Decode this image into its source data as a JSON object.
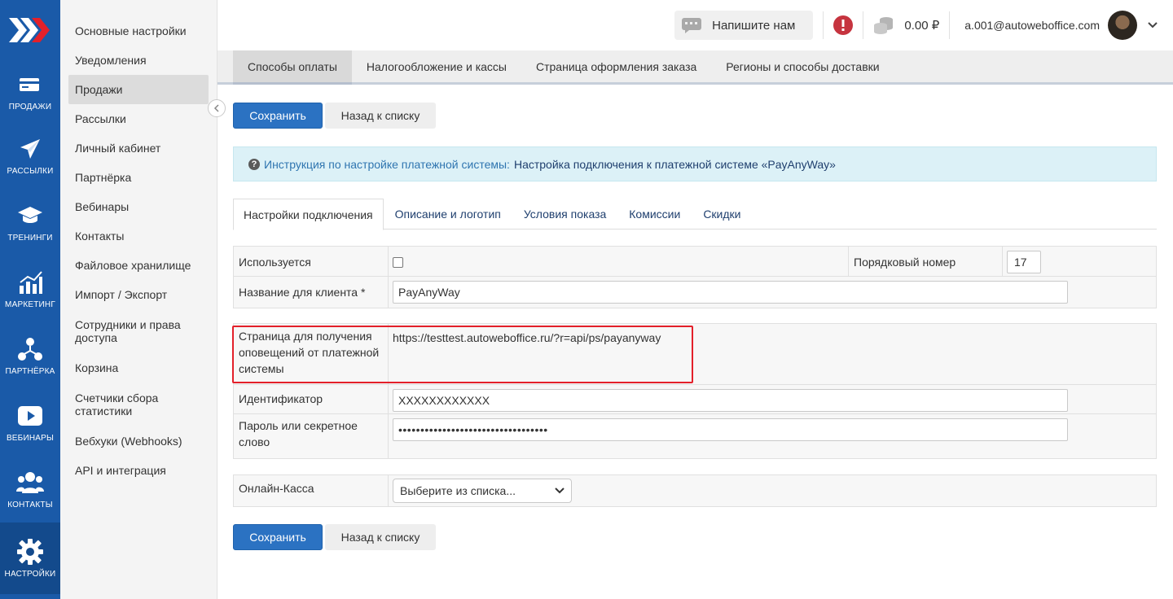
{
  "rail": {
    "items": [
      {
        "label": "Продажи",
        "icon": "card-icon"
      },
      {
        "label": "Рассылки",
        "icon": "paper-plane-icon"
      },
      {
        "label": "Тренинги",
        "icon": "graduation-cap-icon"
      },
      {
        "label": "Маркетинг",
        "icon": "bar-chart-icon"
      },
      {
        "label": "Партнёрка",
        "icon": "network-icon"
      },
      {
        "label": "Вебинары",
        "icon": "play-icon"
      },
      {
        "label": "Контакты",
        "icon": "users-icon"
      },
      {
        "label": "Настройки",
        "icon": "gear-icon"
      }
    ]
  },
  "sidebar": {
    "items": [
      "Основные настройки",
      "Уведомления",
      "Продажи",
      "Рассылки",
      "Личный кабинет",
      "Партнёрка",
      "Вебинары",
      "Контакты",
      "Файловое хранилище",
      "Импорт / Экспорт",
      "Сотрудники и права доступа",
      "Корзина",
      "Счетчики сбора статистики",
      "Вебхуки (Webhooks)",
      "API и интеграция"
    ],
    "active_index": 2
  },
  "header": {
    "write_us": "Напишите нам",
    "balance": "0.00 ₽",
    "email": "a.001@autoweboffice.com"
  },
  "top_tabs": [
    "Способы оплаты",
    "Налогообложение и кассы",
    "Страница оформления заказа",
    "Регионы и способы доставки"
  ],
  "buttons": {
    "save": "Сохранить",
    "back": "Назад к списку"
  },
  "alert": {
    "prefix": "Инструкция по настройке платежной системы:",
    "link": "Настройка подключения к платежной системе «PayAnyWay»"
  },
  "sub_tabs": [
    "Настройки подключения",
    "Описание и логотип",
    "Условия показа",
    "Комиссии",
    "Скидки"
  ],
  "form": {
    "used_label": "Используется",
    "order_label": "Порядковый номер",
    "order_value": "17",
    "client_name_label": "Название для клиента *",
    "client_name_value": "PayAnyWay",
    "notify_label": "Страница для получения оповещений от платежной системы",
    "notify_url": "https://testtest.autoweboffice.ru/?r=api/ps/payanyway",
    "id_label": "Идентификатор",
    "id_value": "XXXXXXXXXXXX",
    "password_label": "Пароль или секретное слово",
    "password_value": "••••••••••••••••••••••••••••••••••",
    "cashbox_label": "Онлайн-Касса",
    "cashbox_select": "Выберите из списка..."
  },
  "colors": {
    "rail": "#1a5aa8",
    "primary": "#2b72c2",
    "highlight": "#e3202a",
    "alert_bg": "#dcf1f7"
  }
}
